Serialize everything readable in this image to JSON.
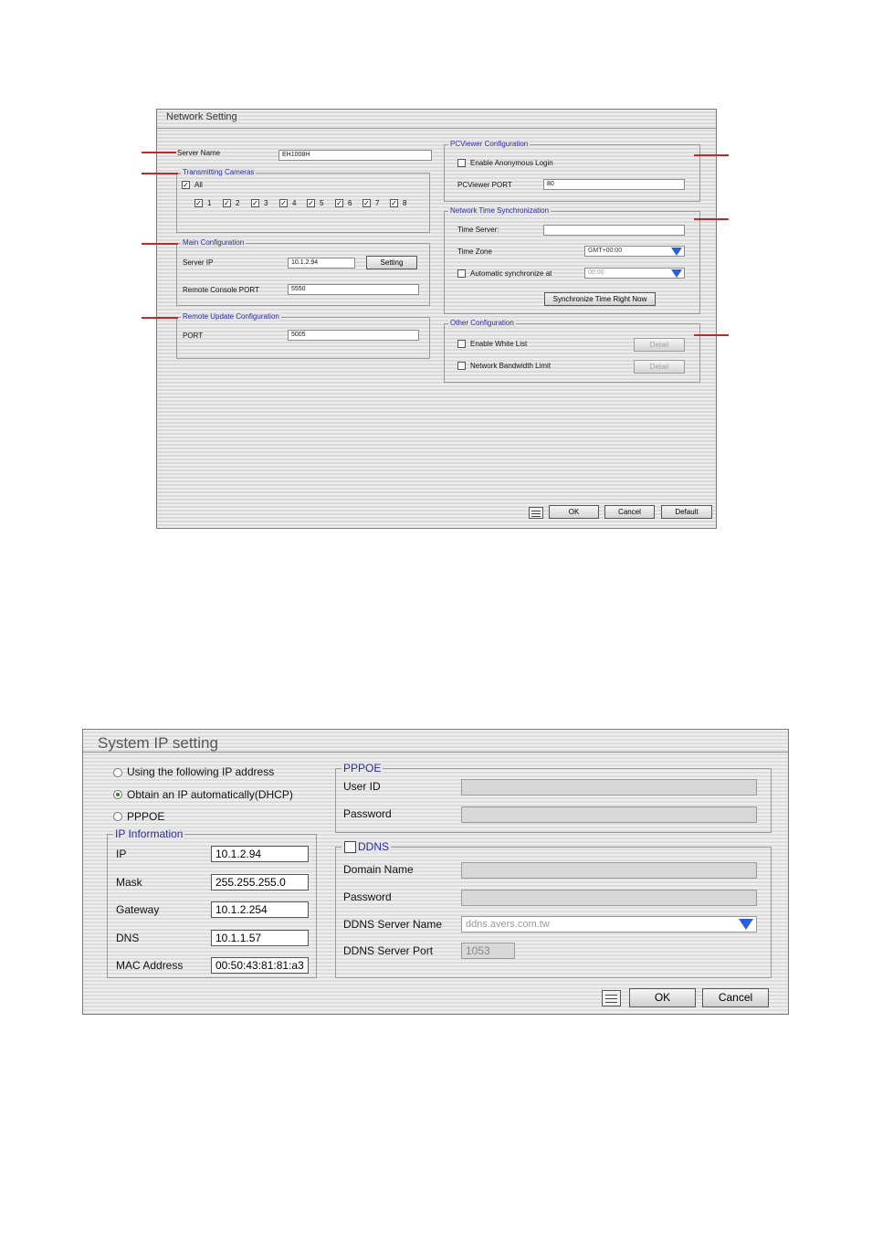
{
  "network_setting": {
    "title": "Network Setting",
    "server_name_label": "Server Name",
    "server_name_value": "EH1008H",
    "transmitting_cameras": {
      "legend": "Transmitting Cameras",
      "all_label": "All",
      "all_checked": true,
      "cameras": [
        {
          "label": "1",
          "checked": true
        },
        {
          "label": "2",
          "checked": true
        },
        {
          "label": "3",
          "checked": true
        },
        {
          "label": "4",
          "checked": true
        },
        {
          "label": "5",
          "checked": true
        },
        {
          "label": "6",
          "checked": true
        },
        {
          "label": "7",
          "checked": true
        },
        {
          "label": "8",
          "checked": true
        }
      ]
    },
    "main_configuration": {
      "legend": "Main Configuration",
      "server_ip_label": "Server IP",
      "server_ip_value": "10.1.2.94",
      "setting_button": "Setting",
      "remote_console_port_label": "Remote Console PORT",
      "remote_console_port_value": "5550"
    },
    "remote_update": {
      "legend": "Remote Update Configuration",
      "port_label": "PORT",
      "port_value": "5005"
    },
    "pcviewer": {
      "legend": "PCViewer Configuration",
      "anonymous_label": "Enable Anonymous Login",
      "anonymous_checked": false,
      "port_label": "PCViewer PORT",
      "port_value": "80"
    },
    "time_sync": {
      "legend": "Network Time Synchronization",
      "time_server_label": "Time Server:",
      "time_server_value": "",
      "time_zone_label": "Time Zone",
      "time_zone_value": "GMT+00:00",
      "auto_sync_label": "Automatic synchronize at",
      "auto_sync_checked": false,
      "auto_sync_value": "00:00",
      "sync_now_button": "Synchronize Time Right Now"
    },
    "other": {
      "legend": "Other Configuration",
      "white_list_label": "Enable White List",
      "bandwidth_label": "Network Bandwidth Limit",
      "detail_button": "Detail"
    },
    "buttons": {
      "ok": "OK",
      "cancel": "Cancel",
      "default": "Default"
    }
  },
  "system_ip_setting": {
    "title": "System IP setting",
    "radio_options": [
      {
        "label": "Using the following IP address",
        "selected": false
      },
      {
        "label": "Obtain an IP automatically(DHCP)",
        "selected": true
      },
      {
        "label": "PPPOE",
        "selected": false
      }
    ],
    "ip_information": {
      "legend": "IP Information",
      "fields": [
        {
          "label": "IP",
          "value": "10.1.2.94"
        },
        {
          "label": "Mask",
          "value": "255.255.255.0"
        },
        {
          "label": "Gateway",
          "value": "10.1.2.254"
        },
        {
          "label": "DNS",
          "value": "10.1.1.57"
        },
        {
          "label": "MAC Address",
          "value": "00:50:43:81:81:a3"
        }
      ]
    },
    "pppoe": {
      "legend": "PPPOE",
      "user_id_label": "User ID",
      "password_label": "Password"
    },
    "ddns": {
      "legend": "DDNS",
      "checked": false,
      "domain_name_label": "Domain Name",
      "password_label": "Password",
      "server_name_label": "DDNS Server Name",
      "server_name_value": "ddns.avers.com.tw",
      "server_port_label": "DDNS Server Port",
      "server_port_value": "1053"
    },
    "buttons": {
      "ok": "OK",
      "cancel": "Cancel"
    }
  },
  "colors": {
    "callout_line": "#c0282d",
    "legend_text": "#2a2aa0",
    "dropdown_arrow": "#2b5fd9"
  }
}
